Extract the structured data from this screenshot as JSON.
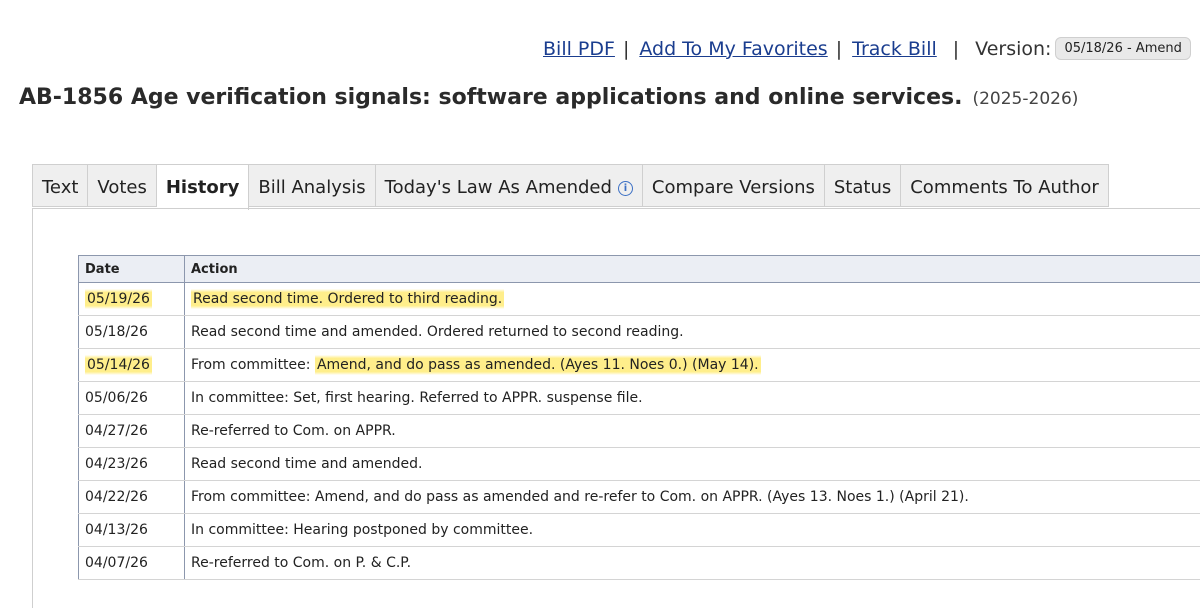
{
  "toolbar": {
    "bill_pdf": "Bill PDF",
    "add_favorites": "Add To My Favorites",
    "track_bill": "Track Bill",
    "version_label": "Version:",
    "version_value": "05/18/26 - Amend",
    "separator": "|"
  },
  "bill": {
    "title": "AB-1856 Age verification signals: software applications and online services.",
    "session": "(2025-2026)"
  },
  "tabs": [
    {
      "label": "Text",
      "active": false
    },
    {
      "label": "Votes",
      "active": false
    },
    {
      "label": "History",
      "active": true
    },
    {
      "label": "Bill Analysis",
      "active": false
    },
    {
      "label": "Today's Law As Amended",
      "active": false
    },
    {
      "label": "Compare Versions",
      "active": false
    },
    {
      "label": "Status",
      "active": false
    },
    {
      "label": "Comments To Author",
      "active": false
    }
  ],
  "history": {
    "headers": {
      "date": "Date",
      "action": "Action"
    },
    "rows": [
      {
        "date": "05/19/26",
        "prefix": "",
        "action": "Read second time. Ordered to third reading.",
        "highlight": true
      },
      {
        "date": "05/18/26",
        "prefix": "",
        "action": "Read second time and amended. Ordered returned to second reading.",
        "highlight": false
      },
      {
        "date": "05/14/26",
        "prefix": "From committee: ",
        "action": "Amend, and do pass as amended. (Ayes 11. Noes 0.) (May 14).",
        "highlight": true
      },
      {
        "date": "05/06/26",
        "prefix": "",
        "action": "In committee: Set, first hearing. Referred to APPR. suspense file.",
        "highlight": false
      },
      {
        "date": "04/27/26",
        "prefix": "",
        "action": "Re-referred to Com. on APPR.",
        "highlight": false
      },
      {
        "date": "04/23/26",
        "prefix": "",
        "action": "Read second time and amended.",
        "highlight": false
      },
      {
        "date": "04/22/26",
        "prefix": "",
        "action": "From committee: Amend, and do pass as amended and re-refer to Com. on APPR. (Ayes 13. Noes 1.) (April 21).",
        "highlight": false
      },
      {
        "date": "04/13/26",
        "prefix": "",
        "action": "In committee: Hearing postponed by committee.",
        "highlight": false
      },
      {
        "date": "04/07/26",
        "prefix": "",
        "action": "Re-referred to Com. on P. & C.P.",
        "highlight": false
      }
    ]
  },
  "colors": {
    "link": "#1a3d8f",
    "highlight": "#ffe964",
    "table_header_bg": "#ebeef4"
  }
}
